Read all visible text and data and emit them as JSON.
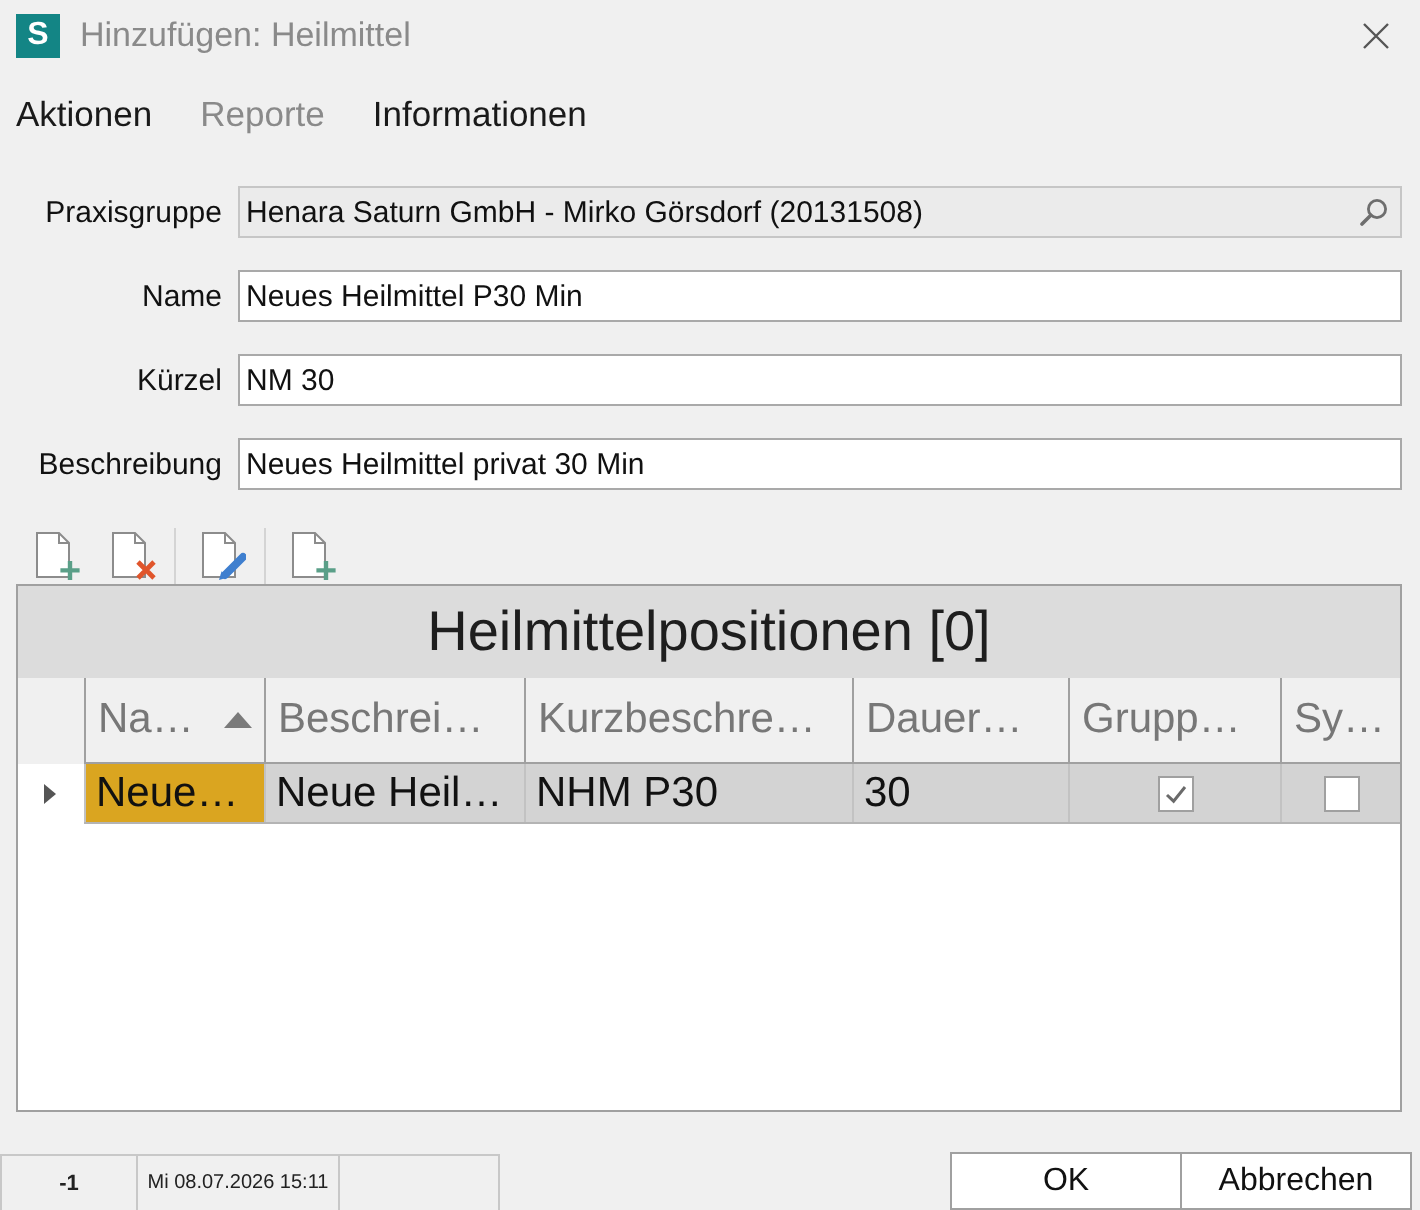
{
  "window": {
    "app_logo": "S",
    "title": "Hinzufügen: Heilmittel"
  },
  "menu": [
    {
      "label": "Aktionen",
      "disabled": false
    },
    {
      "label": "Reporte",
      "disabled": true
    },
    {
      "label": "Informationen",
      "disabled": false
    }
  ],
  "form": [
    {
      "kind": "lookup",
      "label": "Praxisgruppe",
      "value": "Henara Saturn GmbH - Mirko Görsdorf (20131508)"
    },
    {
      "kind": "text",
      "label": "Name",
      "value": "Neues Heilmittel P30 Min"
    },
    {
      "kind": "text",
      "label": "Kürzel",
      "value": "NM 30"
    },
    {
      "kind": "text",
      "label": "Beschreibung",
      "value": "Neues Heilmittel privat 30 Min"
    }
  ],
  "grid": {
    "title": "Heilmittelpositionen [0]",
    "columns": [
      {
        "label": "Na…",
        "sorted": true
      },
      {
        "label": "Beschrei…",
        "sorted": false
      },
      {
        "label": "Kurzbeschre…",
        "sorted": false
      },
      {
        "label": "Dauer…",
        "sorted": false
      },
      {
        "label": "Grupp…",
        "sorted": false
      },
      {
        "label": "Sy…",
        "sorted": false
      }
    ],
    "rows": [
      {
        "selected": true,
        "current": true,
        "cells": [
          {
            "kind": "text",
            "value": "Neue…",
            "focused": true
          },
          {
            "kind": "text",
            "value": "Neue Heil…",
            "focused": false
          },
          {
            "kind": "text",
            "value": "NHM P30",
            "focused": false
          },
          {
            "kind": "text",
            "value": "30",
            "focused": false
          },
          {
            "kind": "checkbox",
            "checked": true
          },
          {
            "kind": "checkbox",
            "checked": false
          }
        ]
      }
    ]
  },
  "status_bar": {
    "record_count": "-1",
    "timestamp": "Mi 08.07.2026 15:11"
  },
  "buttons": [
    {
      "label": "OK"
    },
    {
      "label": "Abbrechen"
    }
  ]
}
